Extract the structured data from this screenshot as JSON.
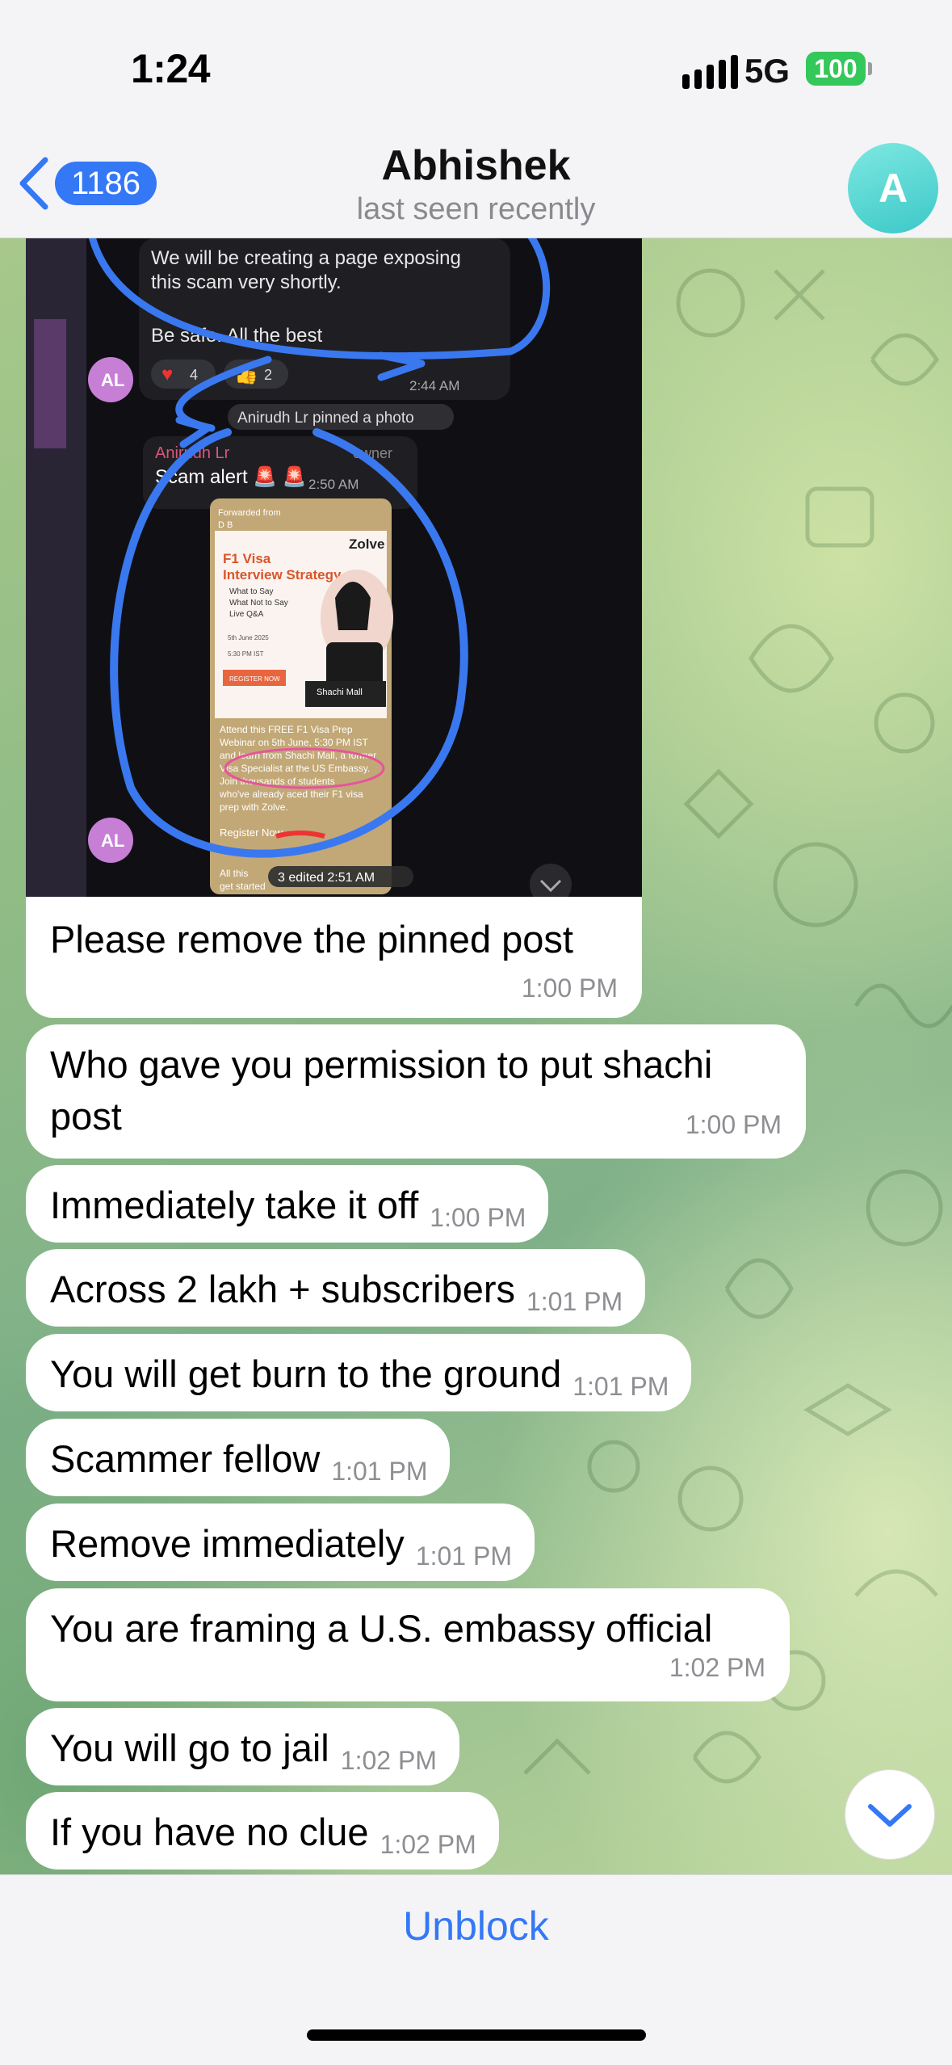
{
  "status_bar": {
    "time": "1:24",
    "network": "5G",
    "battery": "100"
  },
  "header": {
    "back_count": "1186",
    "contact_name": "Abhishek",
    "status": "last seen recently",
    "avatar_letter": "A"
  },
  "screenshot_content": {
    "text_line1": "We will be creating a page exposing",
    "text_line2": "this scam very shortly.",
    "text_line3": "Be safe. All the best",
    "avatar_initials": "AL",
    "heart_count": "4",
    "thumbs_count": "2",
    "time1": "2:44 AM",
    "pin_notice": "Anirudh Lr pinned a photo",
    "sender_name": "Anirudh Lr",
    "sender_role": "owner",
    "scam_text": "Scam alert 🚨 🚨",
    "time2": "2:50 AM",
    "forwarded_label": "Forwarded from",
    "forwarded_src": "D B",
    "brand": "Zolve",
    "poster_title_1": "F1 Visa",
    "poster_title_2": "Interview Strategy",
    "bullets": [
      "What to Say",
      "What Not to Say",
      "Live Q&A"
    ],
    "date": "5th June 2025",
    "time_ist": "5:30 PM IST",
    "register_btn": "REGISTER NOW",
    "speaker": "Shachi Mall",
    "desc_1": "Attend this FREE F1 Visa Prep",
    "desc_2": "Webinar on 5th June, 5:30 PM IST",
    "desc_3": "and learn from Shachi Mall, a former",
    "desc_4": "Visa Specialist at the US Embassy.",
    "desc_5": "Join thousands of students",
    "desc_6": "who've already aced their F1 visa",
    "desc_7": "prep with Zolve.",
    "register_link": "Register Now",
    "all_this": "All this",
    "get_started": "get started",
    "edited": "3  edited 2:51 AM"
  },
  "image_message": {
    "caption": "Please remove the pinned post",
    "time": "1:00 PM"
  },
  "messages": [
    {
      "text": "Who gave you permission to put shachi post",
      "time": "1:00 PM"
    },
    {
      "text": "Immediately take it off",
      "time": "1:00 PM"
    },
    {
      "text": "Across 2 lakh + subscribers",
      "time": "1:01 PM"
    },
    {
      "text": "You will get burn to the ground",
      "time": "1:01 PM"
    },
    {
      "text": "Scammer fellow",
      "time": "1:01 PM"
    },
    {
      "text": "Remove immediately",
      "time": "1:01 PM"
    },
    {
      "text": "You are framing a U.S. embassy official",
      "time": "1:02 PM"
    },
    {
      "text": "You will go to jail",
      "time": "1:02 PM"
    },
    {
      "text": "If you have no clue",
      "time": "1:02 PM"
    }
  ],
  "bottom_bar": {
    "action": "Unblock"
  },
  "colors": {
    "accent": "#3478f6",
    "battery": "#34c759",
    "annotation": "#3a78f0"
  }
}
